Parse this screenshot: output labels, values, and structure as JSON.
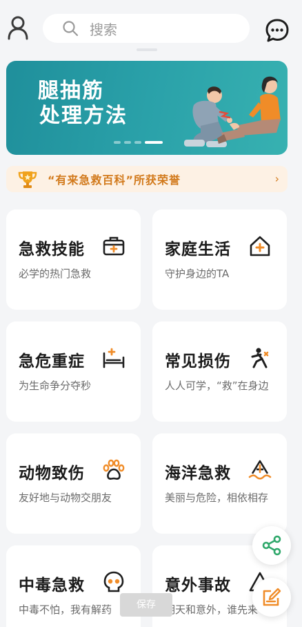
{
  "search": {
    "placeholder": "搜索"
  },
  "banner": {
    "title_line1": "腿抽筋",
    "title_line2": "处理方法",
    "slides": 4,
    "active_slide": 4
  },
  "honor": {
    "text": "“有来急救百科”所获荣誉",
    "chevron": "›"
  },
  "cards": [
    {
      "title": "急救技能",
      "subtitle": "必学的热门急救",
      "icon": "first-aid-kit-icon"
    },
    {
      "title": "家庭生活",
      "subtitle": "守护身边的TA",
      "icon": "house-plus-icon"
    },
    {
      "title": "急危重症",
      "subtitle": "为生命争分夺秒",
      "icon": "hospital-bed-icon"
    },
    {
      "title": "常见损伤",
      "subtitle": "人人可学，“救”在身边",
      "icon": "injured-person-icon"
    },
    {
      "title": "动物致伤",
      "subtitle": "友好地与动物交朋友",
      "icon": "paw-icon"
    },
    {
      "title": "海洋急救",
      "subtitle": "美丽与危险，相依相存",
      "icon": "ocean-rescue-icon"
    },
    {
      "title": "中毒急救",
      "subtitle": "中毒不怕，我有解药",
      "icon": "skull-icon"
    },
    {
      "title": "意外事故",
      "subtitle": "明天和意外，谁先来",
      "icon": "warning-triangle-icon"
    }
  ],
  "save_label": "保存",
  "colors": {
    "accent_orange": "#f08c28",
    "banner_teal": "#2aa1a9",
    "honor_text": "#d27a1c",
    "share_green": "#2fa86b"
  }
}
